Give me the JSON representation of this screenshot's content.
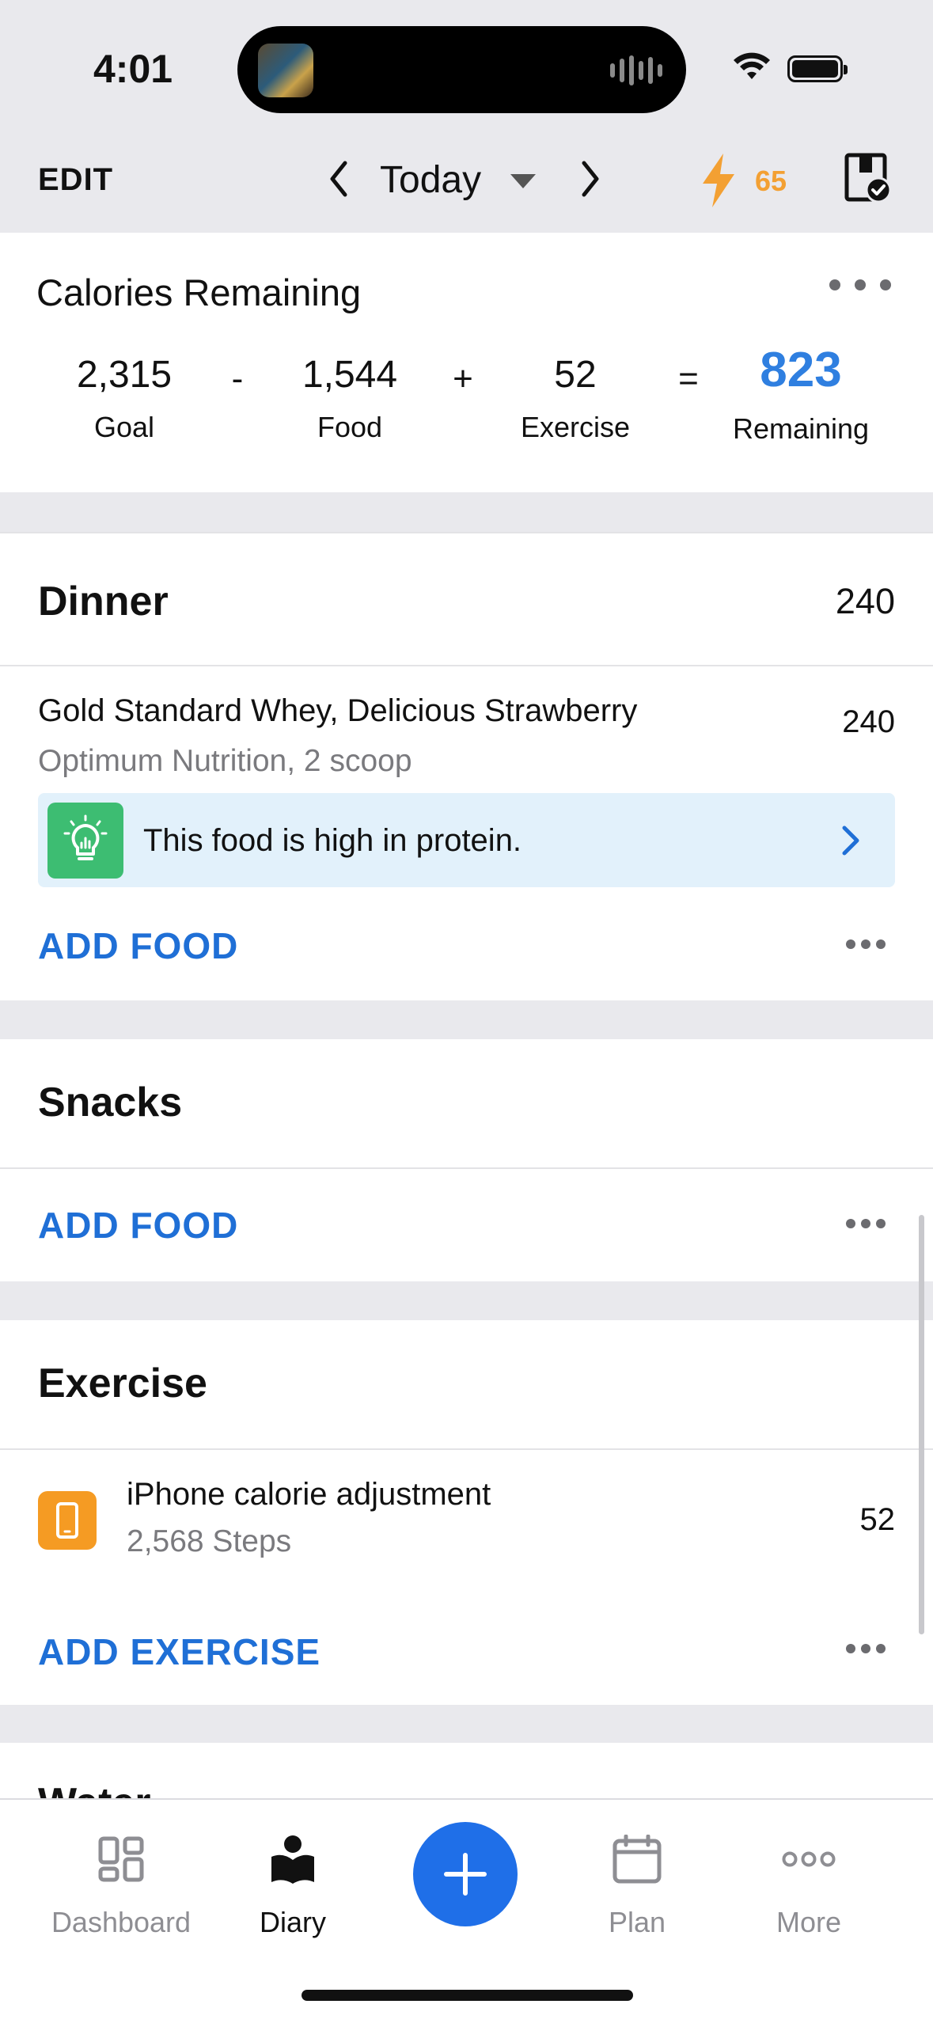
{
  "status_bar": {
    "time": "4:01"
  },
  "header": {
    "edit_label": "EDIT",
    "date_label": "Today",
    "streak_count": "65",
    "colors": {
      "streak": "#f3a033"
    }
  },
  "calories": {
    "title": "Calories Remaining",
    "goal": {
      "value": "2,315",
      "label": "Goal"
    },
    "food": {
      "value": "1,544",
      "label": "Food"
    },
    "exercise": {
      "value": "52",
      "label": "Exercise"
    },
    "remaining": {
      "value": "823",
      "label": "Remaining"
    },
    "ops": {
      "minus": "-",
      "plus": "+",
      "equals": "="
    },
    "accent_color": "#2f7fe0"
  },
  "dinner": {
    "title": "Dinner",
    "total": "240",
    "items": [
      {
        "name": "Gold Standard Whey, Delicious Strawberry",
        "detail": "Optimum Nutrition, 2 scoop",
        "calories": "240"
      }
    ],
    "tip": "This food is high in protein.",
    "add_label": "ADD FOOD"
  },
  "snacks": {
    "title": "Snacks",
    "add_label": "ADD FOOD"
  },
  "exercise": {
    "title": "Exercise",
    "items": [
      {
        "name": "iPhone calorie adjustment",
        "detail": "2,568 Steps",
        "calories": "52",
        "icon": "phone-icon"
      }
    ],
    "add_label": "ADD EXERCISE"
  },
  "next_section_peek": "Water",
  "tabbar": {
    "items": [
      {
        "label": "Dashboard",
        "icon": "dashboard-icon",
        "active": false
      },
      {
        "label": "Diary",
        "icon": "diary-icon",
        "active": true
      },
      {
        "label": "Plan",
        "icon": "calendar-icon",
        "active": false
      },
      {
        "label": "More",
        "icon": "more-icon",
        "active": false
      }
    ],
    "fab_icon": "plus-icon",
    "fab_color": "#1f6fe8"
  }
}
